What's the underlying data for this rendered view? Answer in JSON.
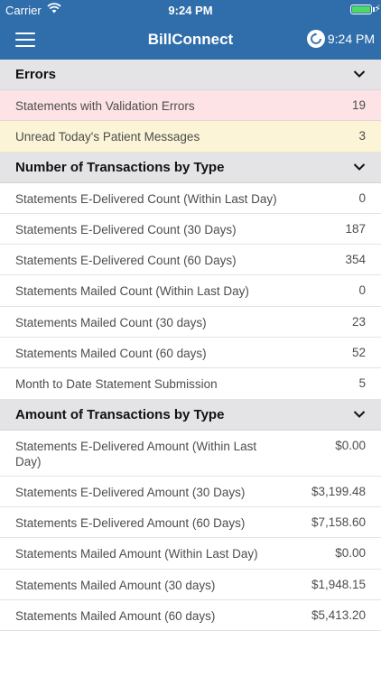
{
  "status_bar": {
    "carrier": "Carrier",
    "time": "9:24 PM"
  },
  "nav": {
    "title": "BillConnect",
    "time": "9:24 PM"
  },
  "errors": {
    "header": "Errors",
    "rows": [
      {
        "label": "Statements with Validation Errors",
        "value": "19"
      },
      {
        "label": "Unread Today's Patient Messages",
        "value": "3"
      }
    ]
  },
  "counts": {
    "header": "Number of Transactions by Type",
    "rows": [
      {
        "label": "Statements E-Delivered Count (Within Last Day)",
        "value": "0"
      },
      {
        "label": "Statements E-Delivered Count (30 Days)",
        "value": "187"
      },
      {
        "label": "Statements E-Delivered Count (60 Days)",
        "value": "354"
      },
      {
        "label": "Statements Mailed Count (Within Last Day)",
        "value": "0"
      },
      {
        "label": "Statements Mailed Count (30 days)",
        "value": "23"
      },
      {
        "label": "Statements Mailed Count (60 days)",
        "value": "52"
      },
      {
        "label": "Month to Date Statement Submission",
        "value": "5"
      }
    ]
  },
  "amounts": {
    "header": "Amount of Transactions by Type",
    "rows": [
      {
        "label": "Statements E-Delivered Amount (Within Last Day)",
        "value": "$0.00"
      },
      {
        "label": "Statements E-Delivered Amount (30 Days)",
        "value": "$3,199.48"
      },
      {
        "label": "Statements E-Delivered Amount (60 Days)",
        "value": "$7,158.60"
      },
      {
        "label": "Statements Mailed Amount (Within Last Day)",
        "value": "$0.00"
      },
      {
        "label": "Statements Mailed Amount (30 days)",
        "value": "$1,948.15"
      },
      {
        "label": "Statements Mailed Amount (60 days)",
        "value": "$5,413.20"
      }
    ]
  },
  "colors": {
    "nav": "#2f6eab",
    "error_row": "#fde3e6",
    "warning_row": "#fbf4d6",
    "header": "#e4e4e6"
  },
  "icons": {
    "menu": "hamburger-icon",
    "refresh": "refresh-icon",
    "collapse": "chevron-down-icon"
  }
}
